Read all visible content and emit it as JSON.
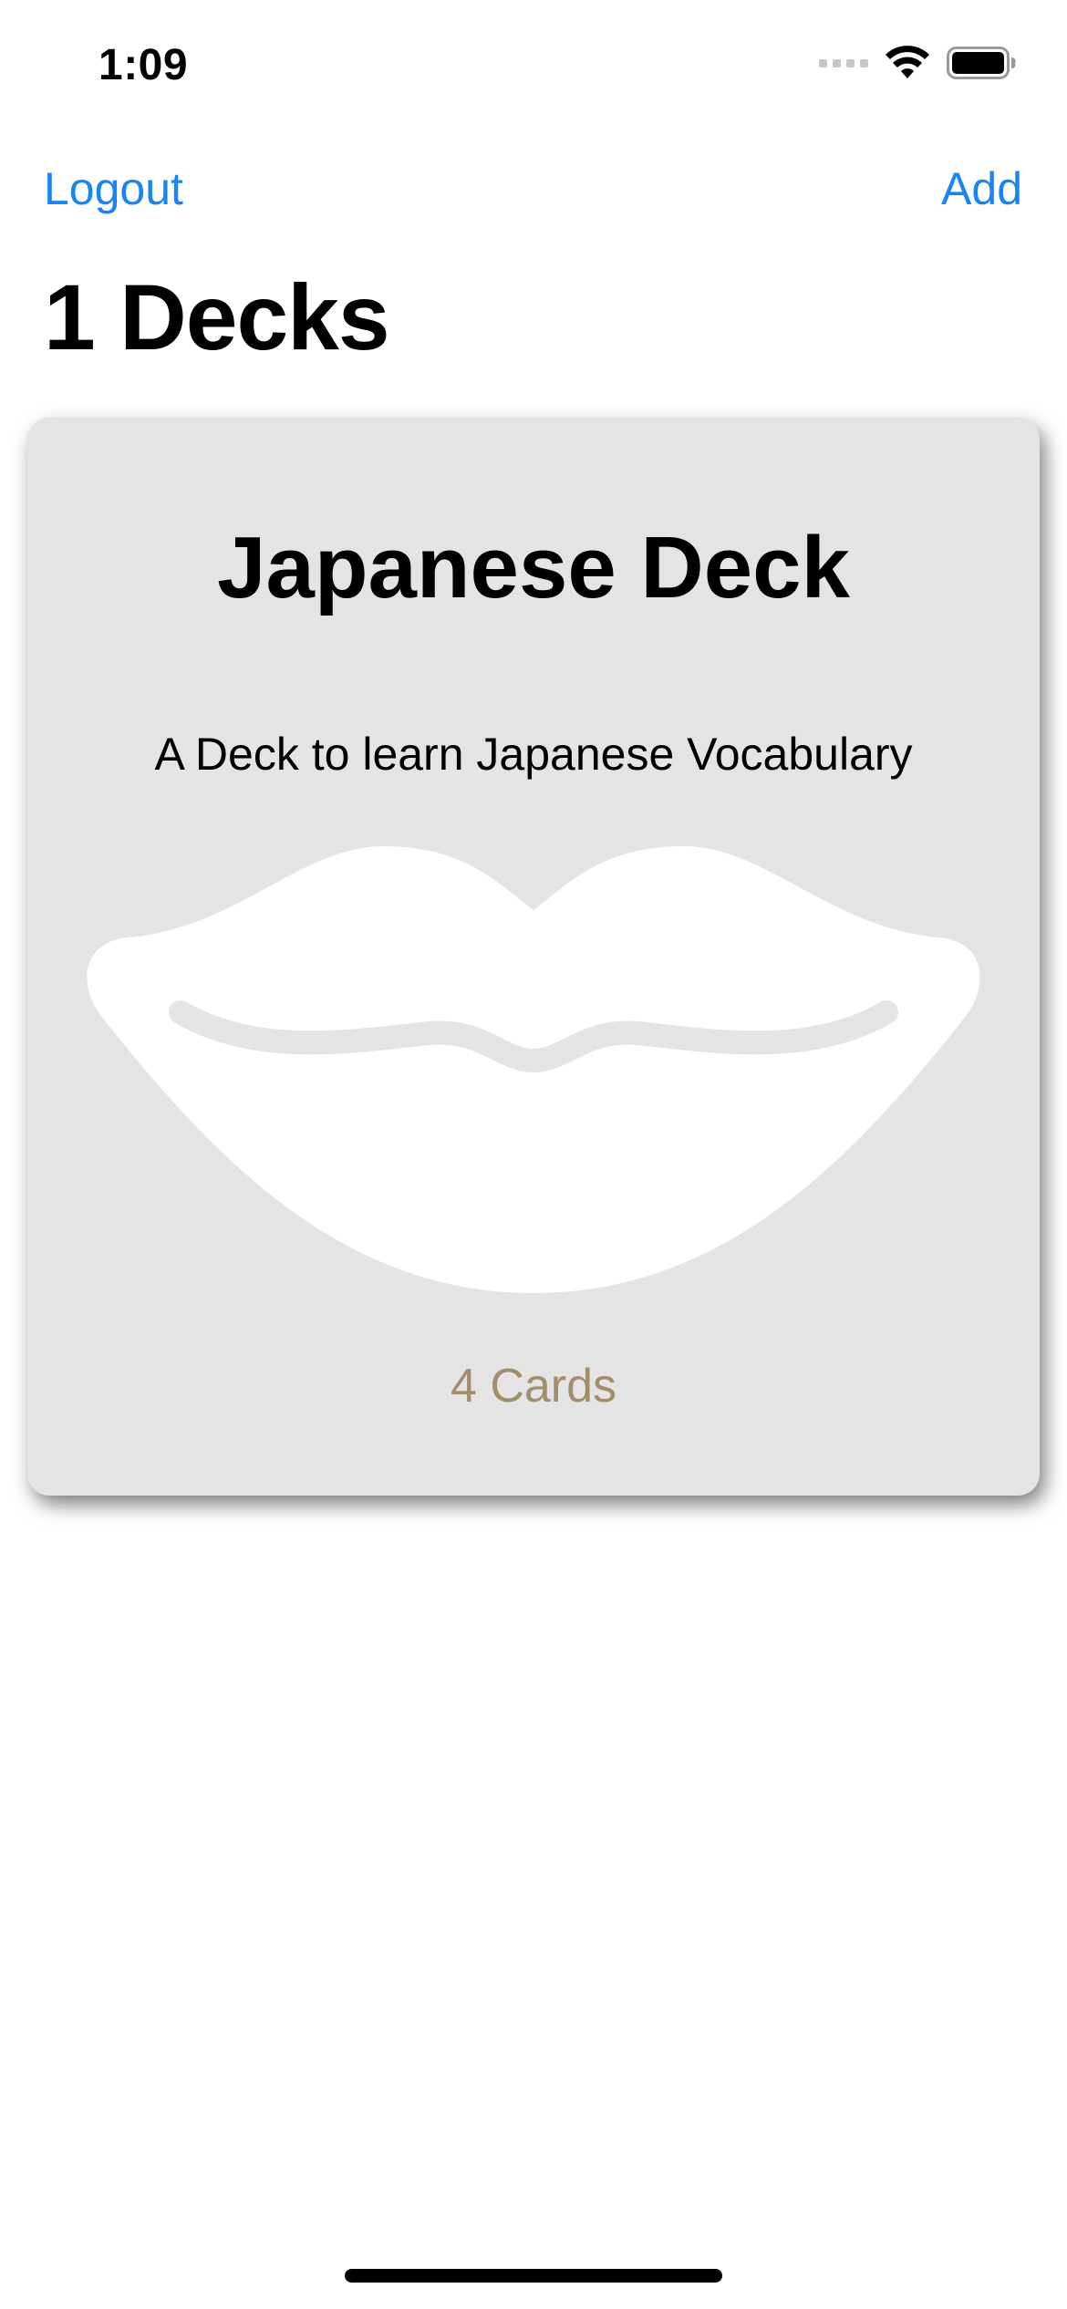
{
  "status_bar": {
    "time": "1:09"
  },
  "nav": {
    "left_label": "Logout",
    "right_label": "Add",
    "accent_color": "#1a84f0"
  },
  "header": {
    "title": "1 Decks"
  },
  "decks": [
    {
      "title": "Japanese Deck",
      "description": "A Deck to learn Japanese Vocabulary",
      "icon": "lips-icon",
      "count_label": "4 Cards",
      "card_color": "#e4e4e4",
      "count_color": "#a18c6c"
    }
  ]
}
